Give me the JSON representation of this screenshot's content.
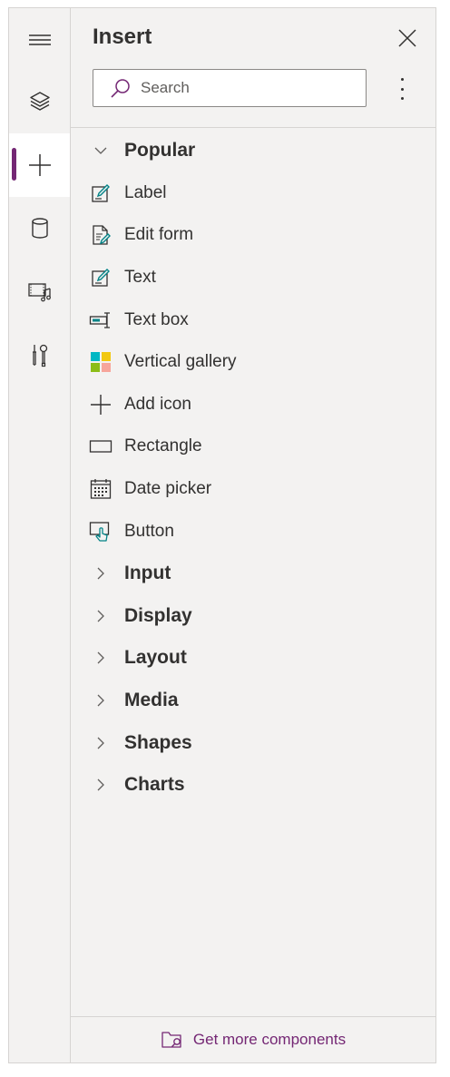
{
  "panel": {
    "title": "Insert",
    "search_placeholder": "Search"
  },
  "rail": {
    "items": [
      {
        "icon": "hamburger-menu-icon"
      },
      {
        "icon": "layers-icon"
      },
      {
        "icon": "plus-icon",
        "active": true
      },
      {
        "icon": "database-icon"
      },
      {
        "icon": "media-icon"
      },
      {
        "icon": "tools-icon"
      }
    ]
  },
  "popular": {
    "label": "Popular",
    "items": [
      {
        "label": "Label",
        "icon": "label-icon"
      },
      {
        "label": "Edit form",
        "icon": "edit-form-icon"
      },
      {
        "label": "Text",
        "icon": "text-icon"
      },
      {
        "label": "Text box",
        "icon": "text-box-icon"
      },
      {
        "label": "Vertical gallery",
        "icon": "vertical-gallery-icon"
      },
      {
        "label": "Add icon",
        "icon": "add-icon"
      },
      {
        "label": "Rectangle",
        "icon": "rectangle-icon"
      },
      {
        "label": "Date picker",
        "icon": "date-picker-icon"
      },
      {
        "label": "Button",
        "icon": "button-icon"
      }
    ]
  },
  "categories": [
    {
      "label": "Input"
    },
    {
      "label": "Display"
    },
    {
      "label": "Layout"
    },
    {
      "label": "Media"
    },
    {
      "label": "Shapes"
    },
    {
      "label": "Charts"
    }
  ],
  "footer": {
    "label": "Get more components"
  },
  "colors": {
    "accent": "#742774",
    "teal": "#038387",
    "panel_bg": "#f3f2f1",
    "text": "#323130"
  }
}
